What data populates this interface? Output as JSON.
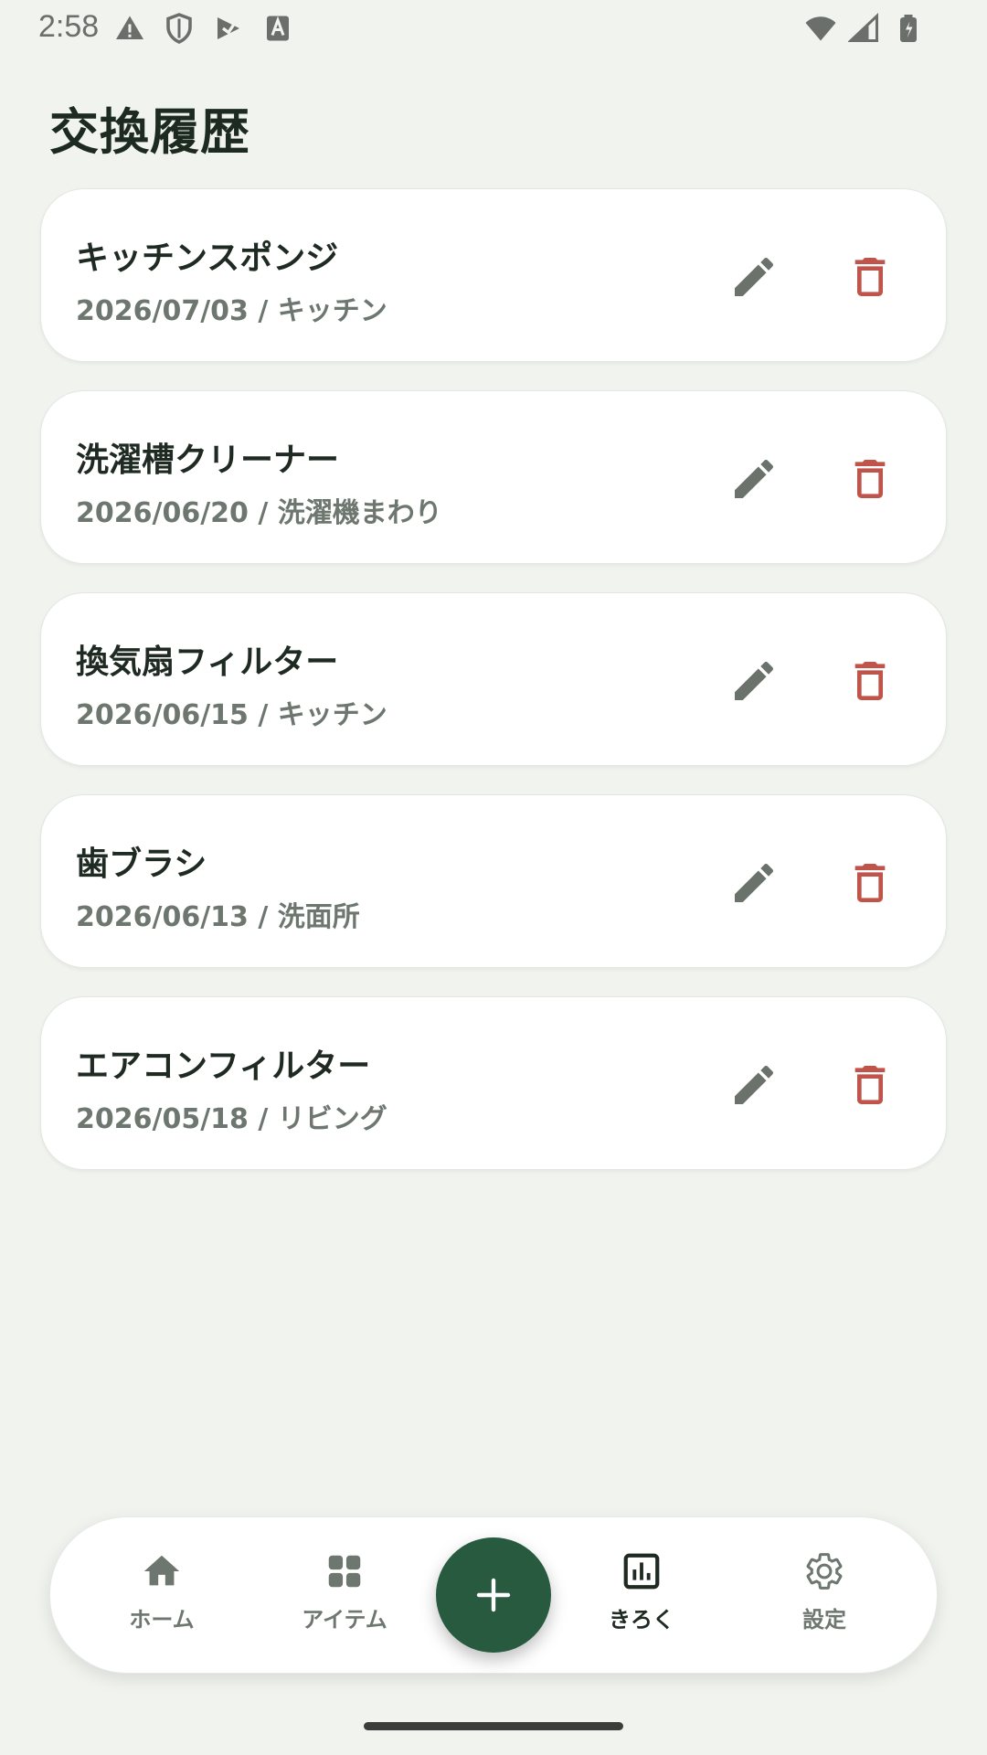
{
  "status_bar": {
    "time": "2:58"
  },
  "page": {
    "title": "交換履歴"
  },
  "history": [
    {
      "name": "キッチンスポンジ",
      "meta": "2026/07/03 / キッチン"
    },
    {
      "name": "洗濯槽クリーナー",
      "meta": "2026/06/20 / 洗濯機まわり"
    },
    {
      "name": "換気扇フィルター",
      "meta": "2026/06/15 / キッチン"
    },
    {
      "name": "歯ブラシ",
      "meta": "2026/06/13 / 洗面所"
    },
    {
      "name": "エアコンフィルター",
      "meta": "2026/05/18 / リビング"
    }
  ],
  "nav": {
    "home": "ホーム",
    "items": "アイテム",
    "records": "きろく",
    "settings": "設定",
    "active": "records"
  },
  "colors": {
    "background": "#f1f3ef",
    "accent": "#275a3f",
    "delete": "#c0544a",
    "edit": "#6b716b",
    "muted_text": "#6d776f"
  },
  "icons": [
    "warning-icon",
    "shield-icon",
    "play-store-icon",
    "text-a-icon",
    "wifi-icon",
    "signal-icon",
    "battery-icon",
    "pencil-icon",
    "trash-icon",
    "home-icon",
    "grid-icon",
    "chart-icon",
    "gear-icon",
    "plus-icon"
  ]
}
